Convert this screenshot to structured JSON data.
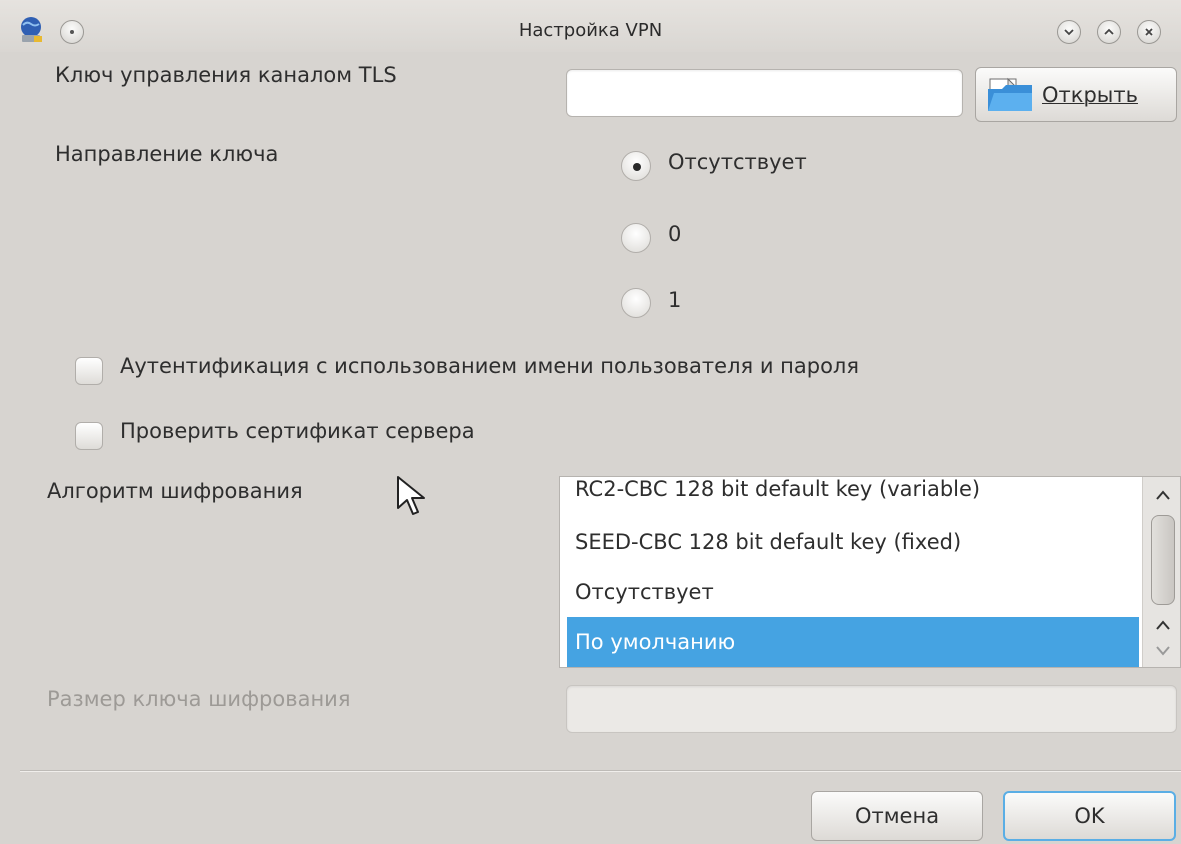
{
  "window": {
    "title": "Настройка VPN",
    "icons": {
      "app": "globe-network-icon",
      "menu": "window-menu-icon",
      "minimize": "minimize-icon",
      "maximize": "maximize-icon",
      "close": "close-icon"
    }
  },
  "tls_key": {
    "label": "Ключ управления каналом TLS",
    "value": "",
    "open_button_label": "Открыть",
    "open_icon": "folder-open-icon"
  },
  "key_direction": {
    "label": "Направление ключа",
    "options": [
      "Отсутствует",
      "0",
      "1"
    ],
    "selected": "Отсутствует"
  },
  "checkboxes": {
    "auth_user_pass": {
      "label": "Аутентификация с использованием имени пользователя и пароля",
      "checked": false
    },
    "verify_server_cert": {
      "label": "Проверить сертификат сервера",
      "checked": false
    }
  },
  "cipher": {
    "label": "Алгоритм шифрования",
    "items": [
      "RC2-CBC 128 bit default key (variable)",
      "SEED-CBC 128 bit default key (fixed)",
      "Отсутствует",
      "По умолчанию"
    ],
    "selected": "По умолчанию"
  },
  "key_size": {
    "label": "Размер ключа шифрования",
    "value": ""
  },
  "buttons": {
    "cancel": "Отмена",
    "ok": "OK"
  },
  "colors": {
    "selection": "#45a3e2",
    "default_button_border": "#5aaee5",
    "window_bg": "#d7d4d0"
  }
}
